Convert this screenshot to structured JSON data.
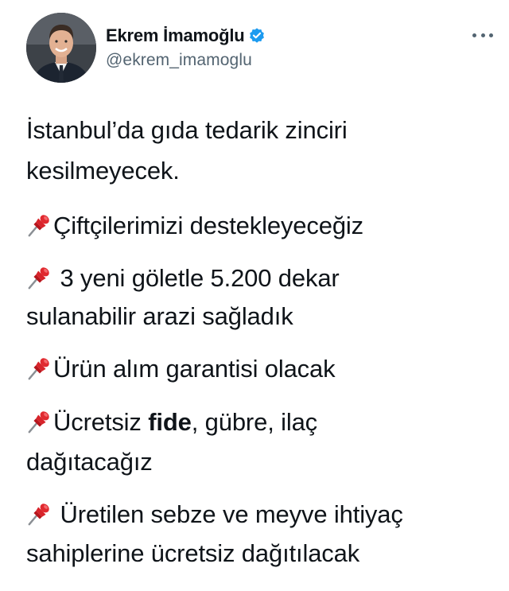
{
  "author": {
    "display_name": "Ekrem İmamoğlu",
    "handle": "@ekrem_imamoglu",
    "verified": true
  },
  "icons": {
    "verified": "verified-badge-icon",
    "more": "more-options-icon",
    "pin": "pushpin-emoji-icon"
  },
  "colors": {
    "text": "#0f1419",
    "secondary": "#536471",
    "verified_blue": "#1d9bf0",
    "pin_red": "#d8232a"
  },
  "tweet": {
    "intro_line1": "İstanbul’da gıda tedarik zinciri",
    "intro_line2": "kesilmeyecek.",
    "item1": "Çiftçilerimizi destekleyeceğiz",
    "item2_line1": " 3 yeni göletle 5.200 dekar",
    "item2_line2": "sulanabilir arazi sağladık",
    "item3": "Ürün alım garantisi olacak",
    "item4_pre": "Ücretsiz ",
    "item4_bold": "fide",
    "item4_post": ", gübre, ilaç",
    "item4_line2": "dağıtacağız",
    "item5_line1": " Üretilen sebze ve meyve ihtiyaç",
    "item5_line2": "sahiplerine ücretsiz dağıtılacak"
  }
}
